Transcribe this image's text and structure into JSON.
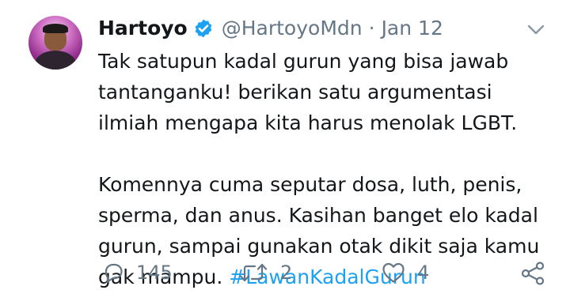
{
  "tweet": {
    "author_name": "Hartoyo",
    "handle": "@HartoyoMdn",
    "separator": "·",
    "date": "Jan 12",
    "line1": "Tak satupun kadal gurun yang bisa jawab tantanganku! berikan satu argumentasi ilmiah mengapa kita harus menolak LGBT.",
    "line2": "Komennya cuma seputar dosa, luth, penis, sperma, dan anus. Kasihan banget elo kadal gurun, sampai gunakan otak dikit saja kamu gak mampu.",
    "hashtag": "#LawanKadalGurun"
  },
  "actions": {
    "reply_count": "145",
    "retweet_count": "2",
    "like_count": "4"
  },
  "icons": {
    "avatar": "profile-photo",
    "verified": "verified-badge-icon",
    "more": "chevron-down-icon",
    "reply": "reply-icon",
    "retweet": "retweet-icon",
    "like": "heart-icon",
    "share": "share-icon"
  },
  "colors": {
    "accent": "#1da1f2",
    "secondary_text": "#657786",
    "primary_text": "#14171a"
  }
}
